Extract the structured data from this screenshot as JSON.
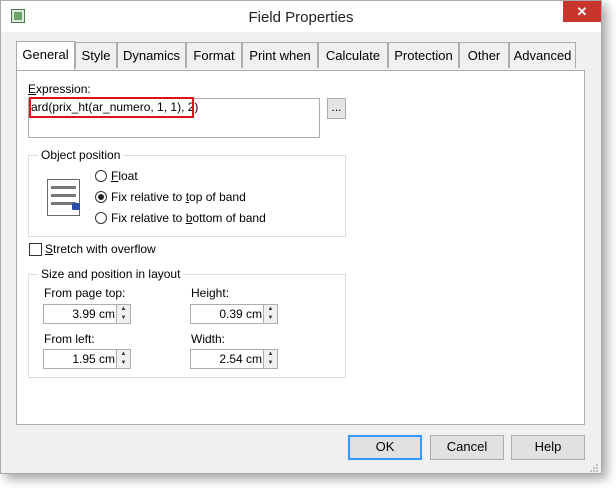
{
  "window": {
    "title": "Field Properties",
    "close_glyph": "✕"
  },
  "tabs": [
    {
      "label": "General",
      "active": true
    },
    {
      "label": "Style"
    },
    {
      "label": "Dynamics"
    },
    {
      "label": "Format"
    },
    {
      "label": "Print when"
    },
    {
      "label": "Calculate"
    },
    {
      "label": "Protection"
    },
    {
      "label": "Other"
    },
    {
      "label": "Advanced"
    }
  ],
  "expression": {
    "label_first": "E",
    "label_rest": "xpression:",
    "value": "ard(prix_ht(ar_numero, 1, 1), 2)",
    "browse_label": "..."
  },
  "object_position": {
    "title": "Object position",
    "options": [
      {
        "pre": "",
        "key": "F",
        "post": "loat",
        "checked": false
      },
      {
        "pre": "Fix relative to ",
        "key": "t",
        "post": "op of band",
        "checked": true
      },
      {
        "pre": "Fix relative to ",
        "key": "b",
        "post": "ottom of band",
        "checked": false
      }
    ]
  },
  "stretch": {
    "key": "S",
    "post": "tretch with overflow",
    "checked": false
  },
  "size_position": {
    "title": "Size and position in layout",
    "from_page_top": {
      "label": "From page top:",
      "value": "3.99 cm"
    },
    "height": {
      "label": "Height:",
      "value": "0.39 cm"
    },
    "from_left": {
      "label": "From left:",
      "value": "1.95 cm"
    },
    "width": {
      "label": "Width:",
      "value": "2.54 cm"
    }
  },
  "buttons": {
    "ok": "OK",
    "cancel": "Cancel",
    "help": "Help"
  },
  "icons": {
    "app": "form-icon",
    "object_position": "document-lock-icon"
  },
  "colors": {
    "highlight": "#e0101c",
    "close": "#c7352d",
    "default_button": "#3399ff"
  }
}
